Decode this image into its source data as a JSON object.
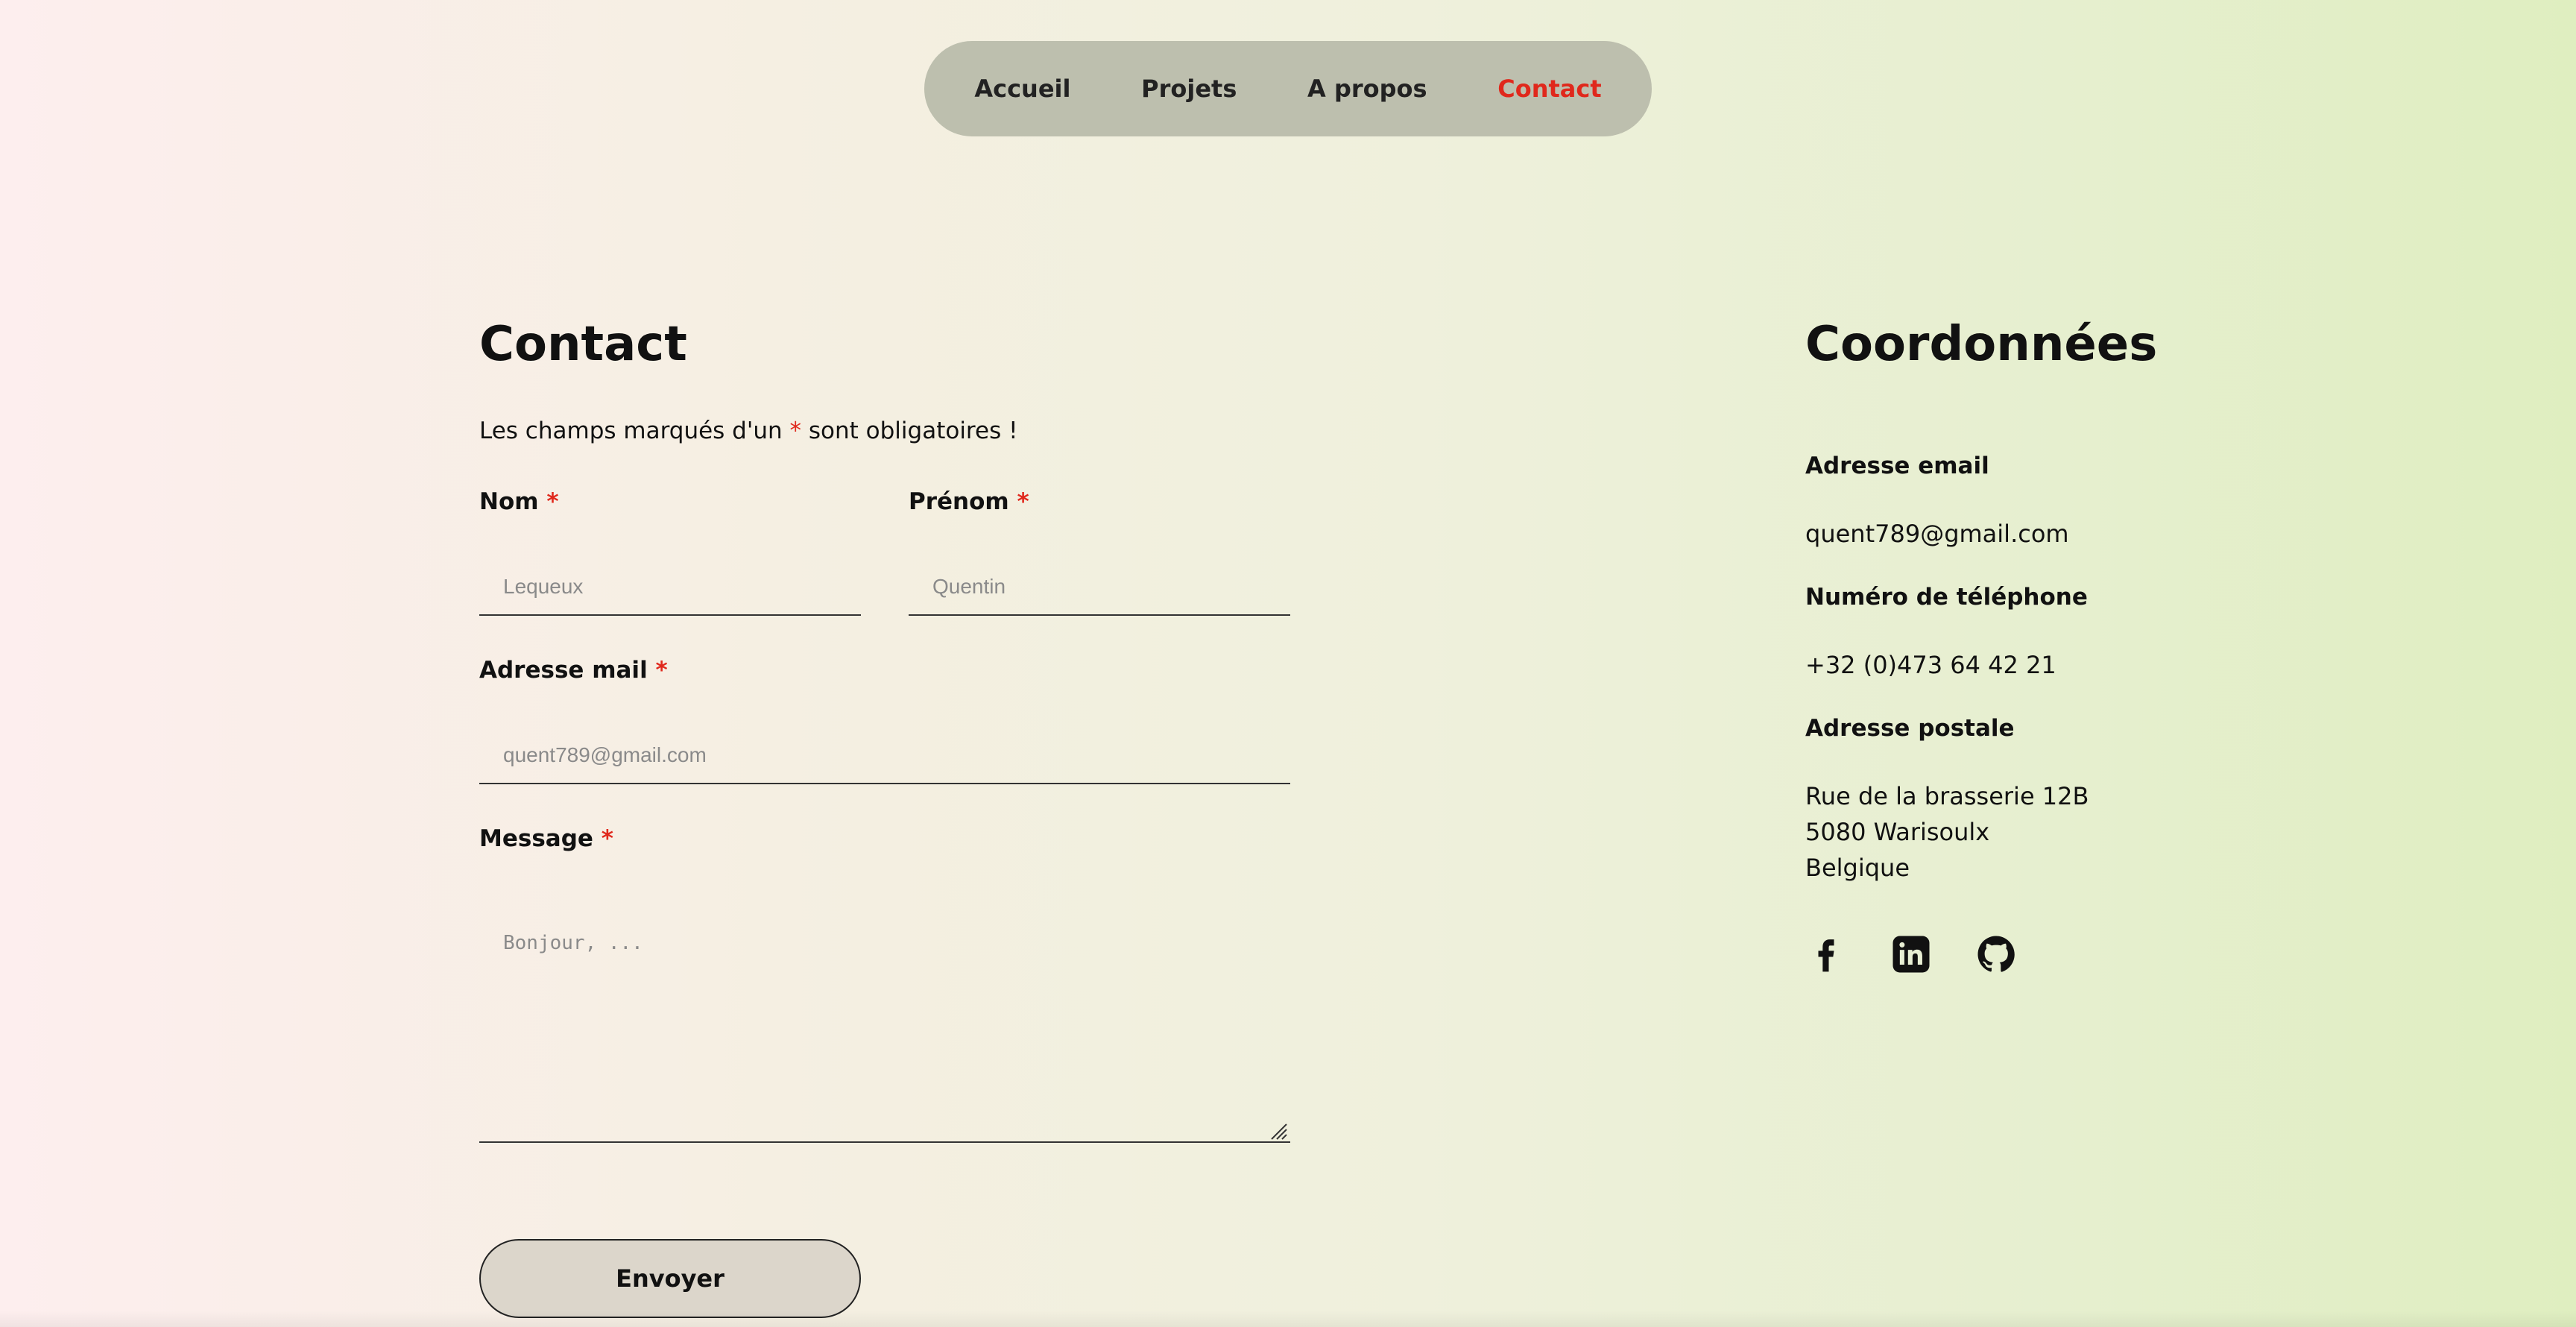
{
  "nav": {
    "items": [
      {
        "label": "Accueil",
        "active": false
      },
      {
        "label": "Projets",
        "active": false
      },
      {
        "label": "A propos",
        "active": false
      },
      {
        "label": "Contact",
        "active": true
      }
    ]
  },
  "contact": {
    "title": "Contact",
    "note_before": "Les champs marqués d'un ",
    "note_star": "*",
    "note_after": " sont obligatoires !",
    "fields": {
      "nom": {
        "label": "Nom",
        "placeholder": "Lequeux",
        "value": ""
      },
      "prenom": {
        "label": "Prénom",
        "placeholder": "Quentin",
        "value": ""
      },
      "email": {
        "label": "Adresse mail",
        "placeholder": "quent789@gmail.com",
        "value": ""
      },
      "message": {
        "label": "Message",
        "placeholder": "Bonjour, ...",
        "value": ""
      }
    },
    "required_mark": "*",
    "submit_label": "Envoyer"
  },
  "coordinates": {
    "title": "Coordonnées",
    "email_label": "Adresse email",
    "email_value": "quent789@gmail.com",
    "phone_label": "Numéro de téléphone",
    "phone_value": "+32 (0)473 64 42 21",
    "address_label": "Adresse postale",
    "address_lines": [
      "Rue de la brasserie 12B",
      "5080 Warisoulx",
      "Belgique"
    ],
    "socials": [
      {
        "icon": "facebook-icon"
      },
      {
        "icon": "linkedin-icon"
      },
      {
        "icon": "github-icon"
      }
    ]
  },
  "colors": {
    "accent": "#e0281c",
    "nav_bg": "#bdbfae",
    "button_bg": "#dcd6cb"
  }
}
